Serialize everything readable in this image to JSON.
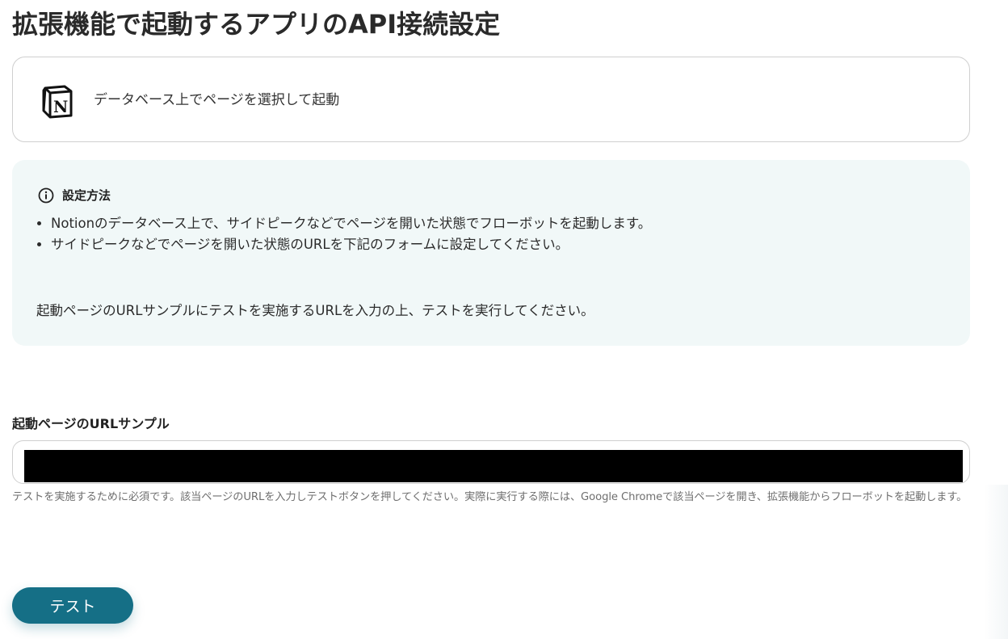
{
  "page": {
    "title": "拡張機能で起動するアプリのAPI接続設定"
  },
  "app_card": {
    "icon": "notion-logo",
    "trigger_label": "データベース上でページを選択して起動"
  },
  "info_box": {
    "icon": "info-circle-icon",
    "title": "設定方法",
    "items": [
      "Notionのデータベース上で、サイドピークなどでページを開いた状態でフローボットを起動します。",
      "サイドピークなどでページを開いた状態のURLを下記のフォームに設定してください。"
    ],
    "note": "起動ページのURLサンプルにテストを実施するURLを入力の上、テストを実行してください。"
  },
  "url_field": {
    "label": "起動ページのURLサンプル",
    "value": "",
    "help": "テストを実施するために必須です。該当ページのURLを入力しテストボタンを押してください。実際に実行する際には、Google Chromeで該当ページを開き、拡張機能からフローボットを起動します。"
  },
  "actions": {
    "test_label": "テスト"
  },
  "colors": {
    "primary_button": "#156f86",
    "info_background": "#f1f8f8",
    "border": "#cfcfcf"
  }
}
